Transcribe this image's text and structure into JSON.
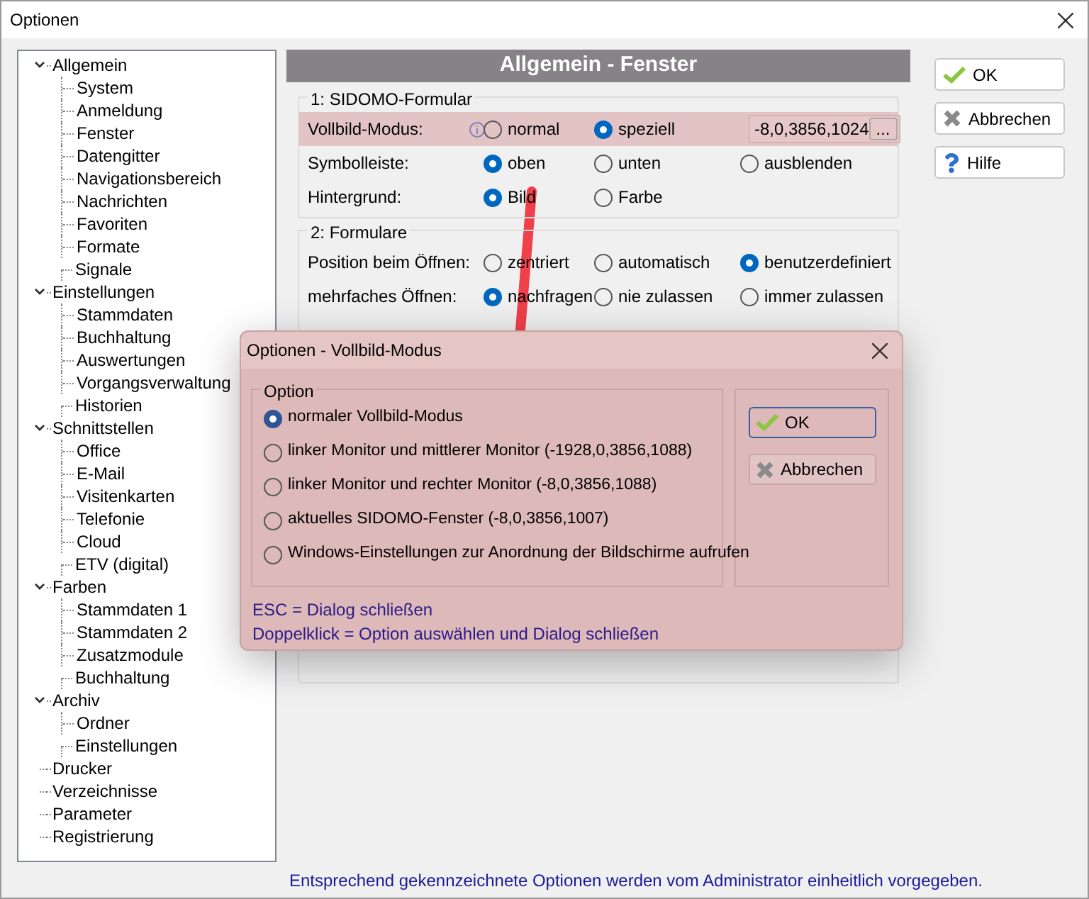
{
  "window": {
    "title": "Optionen"
  },
  "tree": [
    {
      "label": "Allgemein",
      "expanded": true,
      "children": [
        {
          "label": "System"
        },
        {
          "label": "Anmeldung"
        },
        {
          "label": "Fenster"
        },
        {
          "label": "Datengitter"
        },
        {
          "label": "Navigationsbereich"
        },
        {
          "label": "Nachrichten"
        },
        {
          "label": "Favoriten"
        },
        {
          "label": "Formate"
        },
        {
          "label": "Signale"
        }
      ]
    },
    {
      "label": "Einstellungen",
      "expanded": true,
      "children": [
        {
          "label": "Stammdaten"
        },
        {
          "label": "Buchhaltung"
        },
        {
          "label": "Auswertungen"
        },
        {
          "label": "Vorgangsverwaltung"
        },
        {
          "label": "Historien"
        }
      ]
    },
    {
      "label": "Schnittstellen",
      "expanded": true,
      "children": [
        {
          "label": "Office"
        },
        {
          "label": "E-Mail"
        },
        {
          "label": "Visitenkarten"
        },
        {
          "label": "Telefonie"
        },
        {
          "label": "Cloud"
        },
        {
          "label": "ETV (digital)"
        }
      ]
    },
    {
      "label": "Farben",
      "expanded": true,
      "children": [
        {
          "label": "Stammdaten 1"
        },
        {
          "label": "Stammdaten 2"
        },
        {
          "label": "Zusatzmodule"
        },
        {
          "label": "Buchhaltung"
        }
      ]
    },
    {
      "label": "Archiv",
      "expanded": true,
      "children": [
        {
          "label": "Ordner"
        },
        {
          "label": "Einstellungen"
        }
      ]
    },
    {
      "label": "Drucker"
    },
    {
      "label": "Verzeichnisse"
    },
    {
      "label": "Parameter"
    },
    {
      "label": "Registrierung"
    }
  ],
  "panel": {
    "title": "Allgemein - Fenster",
    "groups": [
      {
        "title": "1: SIDOMO-Formular",
        "rows": [
          {
            "label": "Vollbild-Modus:",
            "highlighted": true,
            "info": true,
            "options": [
              {
                "label": "normal",
                "selected": false
              },
              {
                "label": "speziell",
                "selected": true
              }
            ],
            "field": {
              "value": "-8,0,3856,1024",
              "button": "..."
            }
          },
          {
            "label": "Symbolleiste:",
            "highlighted": false,
            "info": false,
            "options": [
              {
                "label": "oben",
                "selected": true
              },
              {
                "label": "unten",
                "selected": false
              },
              {
                "label": "ausblenden",
                "selected": false
              }
            ]
          },
          {
            "label": "Hintergrund:",
            "highlighted": false,
            "info": false,
            "options": [
              {
                "label": "Bild",
                "selected": true
              },
              {
                "label": "Farbe",
                "selected": false
              }
            ]
          }
        ]
      },
      {
        "title": "2: Formulare",
        "rows": [
          {
            "label": "Position beim Öffnen:",
            "highlighted": false,
            "info": false,
            "options": [
              {
                "label": "zentriert",
                "selected": false
              },
              {
                "label": "automatisch",
                "selected": false
              },
              {
                "label": "benutzerdefiniert",
                "selected": true
              }
            ]
          },
          {
            "label": "mehrfaches Öffnen:",
            "highlighted": false,
            "info": false,
            "options": [
              {
                "label": "nachfragen",
                "selected": true
              },
              {
                "label": "nie zulassen",
                "selected": false
              },
              {
                "label": "immer zulassen",
                "selected": false
              }
            ]
          }
        ]
      }
    ]
  },
  "buttons": [
    {
      "label": "OK",
      "kind": "ok"
    },
    {
      "label": "Abbrechen",
      "kind": "cancel"
    },
    {
      "label": "Hilfe",
      "kind": "help"
    }
  ],
  "footer": "Entsprechend gekennzeichnete Optionen werden vom Administrator einheitlich vorgegeben.",
  "dialog": {
    "title": "Optionen - Vollbild-Modus",
    "group_title": "Option",
    "options": [
      {
        "label": "normaler Vollbild-Modus",
        "selected": true
      },
      {
        "label": "linker Monitor und mittlerer Monitor (-1928,0,3856,1088)",
        "selected": false
      },
      {
        "label": "linker Monitor und rechter Monitor (-8,0,3856,1088)",
        "selected": false
      },
      {
        "label": "aktuelles SIDOMO-Fenster (-8,0,3856,1007)",
        "selected": false
      },
      {
        "label": "Windows-Einstellungen zur Anordnung der Bildschirme aufrufen",
        "selected": false
      }
    ],
    "buttons": [
      {
        "label": "OK",
        "kind": "ok"
      },
      {
        "label": "Abbrechen",
        "kind": "cancel"
      }
    ],
    "hints": [
      "ESC = Dialog schließen",
      "Doppelklick = Option auswählen und Dialog schließen"
    ]
  }
}
